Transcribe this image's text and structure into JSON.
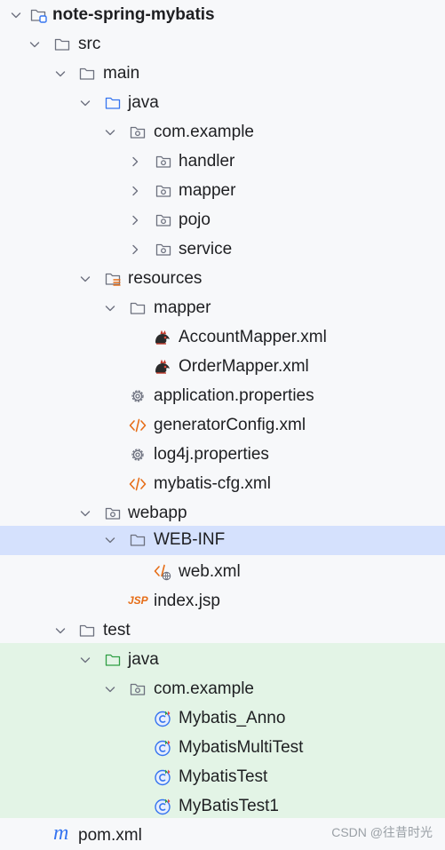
{
  "tree": {
    "project": "note-spring-mybatis",
    "src": "src",
    "main": "main",
    "main_java": "java",
    "main_pkg": "com.example",
    "handler": "handler",
    "mapper_pkg": "mapper",
    "pojo": "pojo",
    "service": "service",
    "resources": "resources",
    "res_mapper": "mapper",
    "account_mapper": "AccountMapper.xml",
    "order_mapper": "OrderMapper.xml",
    "app_props": "application.properties",
    "generator_cfg": "generatorConfig.xml",
    "log4j": "log4j.properties",
    "mybatis_cfg": "mybatis-cfg.xml",
    "webapp": "webapp",
    "web_inf": "WEB-INF",
    "web_xml": "web.xml",
    "index_jsp": "index.jsp",
    "test": "test",
    "test_java": "java",
    "test_pkg": "com.example",
    "t1": "Mybatis_Anno",
    "t2": "MybatisMultiTest",
    "t3": "MybatisTest",
    "t4": "MyBatisTest1",
    "pom": "pom.xml"
  },
  "icons": {
    "jsp_text": "JSP",
    "maven_glyph": "m"
  },
  "watermark": "CSDN @往昔时光",
  "colors": {
    "selection": "#d5e1fd",
    "test_bg": "#e3f4e6",
    "folder": "#6c707e",
    "source_folder": "#3574f0",
    "test_folder": "#2f9e44",
    "orange": "#e66d17"
  }
}
